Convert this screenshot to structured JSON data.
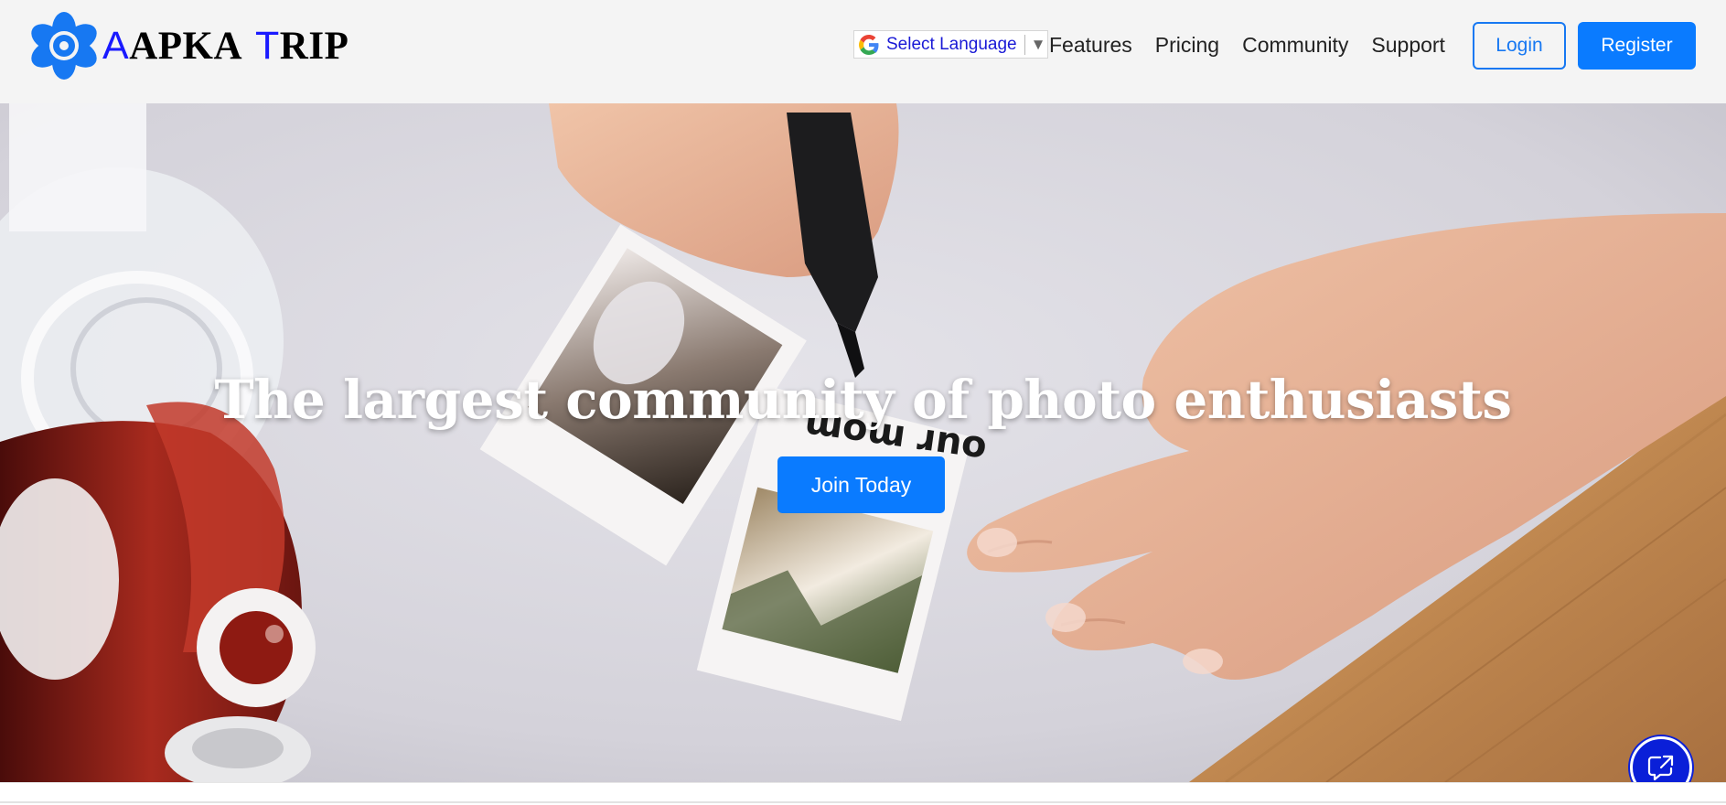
{
  "brand": {
    "first_initial": "A",
    "first_rest": "APKA",
    "second_initial": "T",
    "second_rest": "RIP",
    "logo_icon": "atom-flower-icon"
  },
  "language_selector": {
    "label": "Select Language",
    "icon": "google-g-icon",
    "arrow": "▼"
  },
  "nav": {
    "links": [
      {
        "label": "Features"
      },
      {
        "label": "Pricing"
      },
      {
        "label": "Community"
      },
      {
        "label": "Support"
      }
    ],
    "login_label": "Login",
    "register_label": "Register"
  },
  "hero": {
    "title": "The largest community of photo enthusiasts",
    "cta_label": "Join Today",
    "polaroid_caption": "our mom"
  },
  "chat": {
    "icon": "chat-share-icon"
  },
  "colors": {
    "accent": "#0a7bff",
    "brand_initial": "#1a1aff",
    "navbar_bg": "#f4f4f4",
    "chat_fab": "#0a1fd8"
  }
}
